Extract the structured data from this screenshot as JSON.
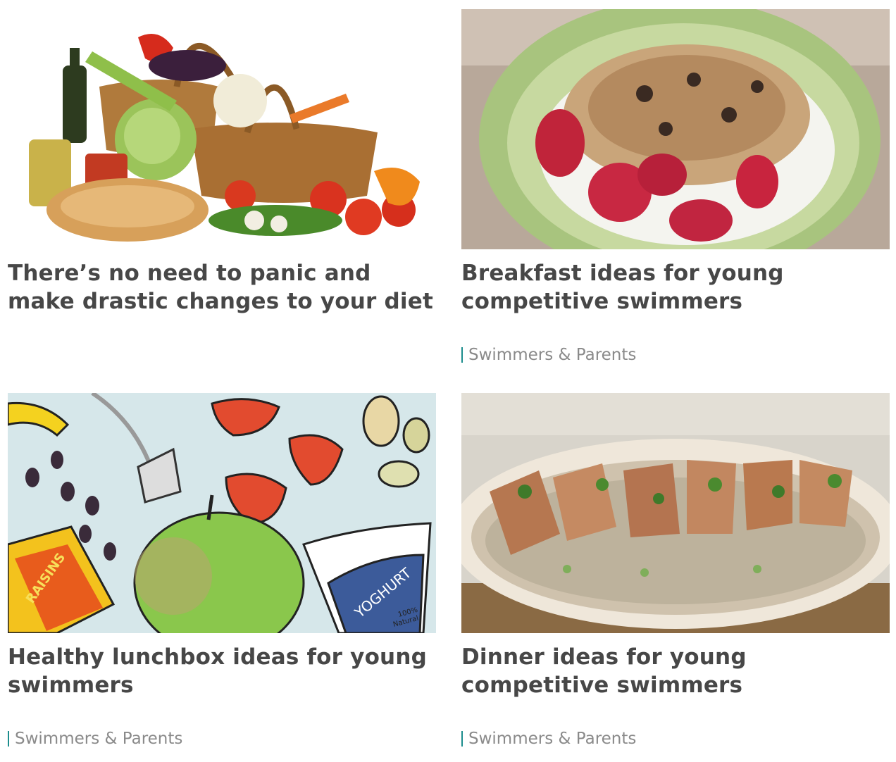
{
  "articles": [
    {
      "title": "There’s no need to panic and make drastic changes to your diet",
      "tag": "",
      "image_icon": "vegetable-basket-image"
    },
    {
      "title": "Breakfast ideas for young competitive swimmers",
      "tag": "Swimmers & Parents",
      "image_icon": "muesli-bowl-image"
    },
    {
      "title": "Healthy lunchbox ideas for young swimmers",
      "tag": "Swimmers & Parents",
      "image_icon": "lunchbox-illustration-image",
      "illustration_labels": {
        "raisins": "RAISINS",
        "yoghurt": "YOGHURT",
        "natural_line1": "100%",
        "natural_line2": "Natural"
      }
    },
    {
      "title": "Dinner ideas for young competitive swimmers",
      "tag": "Swimmers & Parents",
      "image_icon": "chicken-orzo-platter-image"
    }
  ],
  "colors": {
    "title": "#474747",
    "tag_text": "#8a8a8a",
    "tag_bar": "#1c8d8d"
  }
}
